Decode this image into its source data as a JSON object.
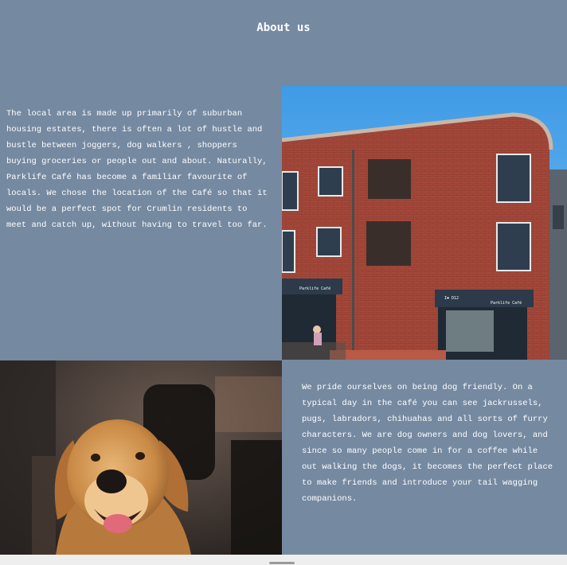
{
  "header": {
    "title": "About us"
  },
  "intro": {
    "text": "The local area is made up primarily of suburban housing estates, there is often a lot of hustle and bustle between joggers, dog walkers , shoppers buying groceries or people out and about. Naturally, Parklife Café has become a familiar favourite of locals. We chose the location of the Café so that it would be a perfect spot for Crumlin residents to meet and catch up, without having to travel too far."
  },
  "building_photo": {
    "sign_left": "Parklife Café",
    "sign_right": "Parklife Café",
    "sign_small": "I❤ D12"
  },
  "dog_section": {
    "text": "We pride ourselves on being dog friendly. On a typical day in the café you can see jackrussels, pugs, labradors, chihuahas and all sorts of furry characters. We are dog owners and dog lovers, and since so many people come in for a coffee while out walking the dogs, it becomes the perfect place to make friends and introduce your tail wagging companions."
  },
  "colors": {
    "background": "#7589a1",
    "text": "#ffffff",
    "sky": "#4aa3ea",
    "brick": "#a3483a"
  }
}
